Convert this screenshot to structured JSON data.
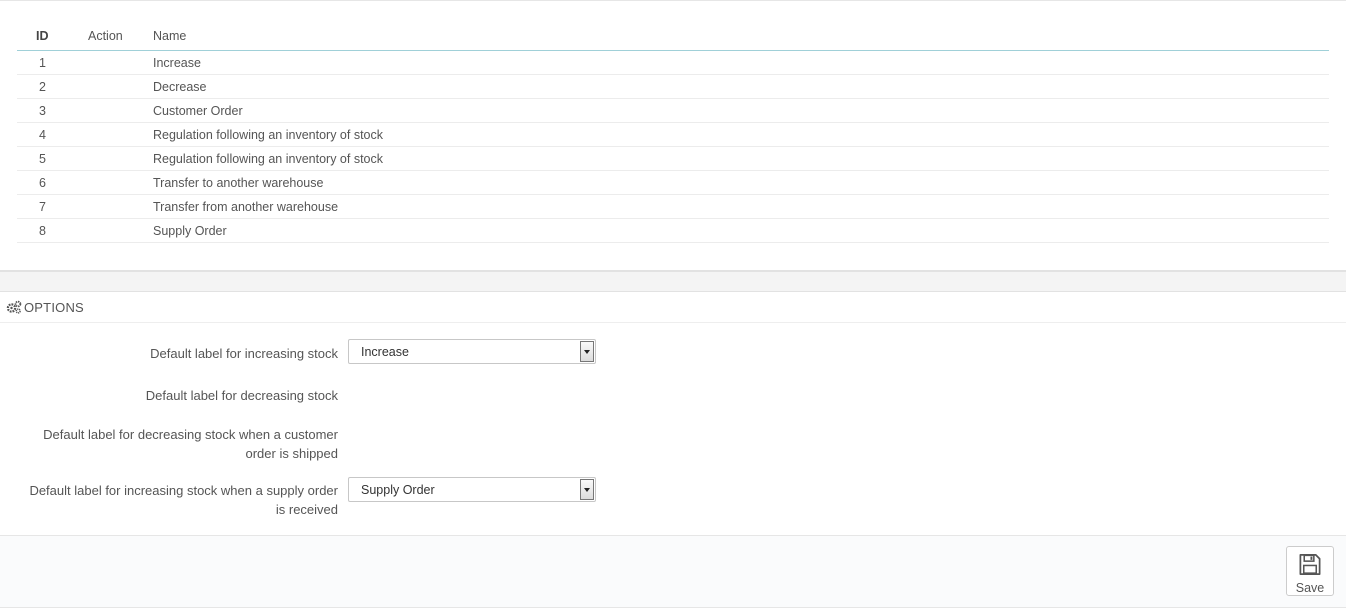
{
  "table": {
    "headers": {
      "id": "ID",
      "action": "Action",
      "name": "Name"
    },
    "rows": [
      {
        "id": "1",
        "name": "Increase"
      },
      {
        "id": "2",
        "name": "Decrease"
      },
      {
        "id": "3",
        "name": "Customer Order"
      },
      {
        "id": "4",
        "name": "Regulation following an inventory of stock"
      },
      {
        "id": "5",
        "name": "Regulation following an inventory of stock"
      },
      {
        "id": "6",
        "name": "Transfer to another warehouse"
      },
      {
        "id": "7",
        "name": "Transfer from another warehouse"
      },
      {
        "id": "8",
        "name": "Supply Order"
      }
    ]
  },
  "options": {
    "heading": "OPTIONS",
    "heading_icon": "cogs-icon",
    "fields": [
      {
        "label": "Default label for increasing stock",
        "value": "Increase"
      },
      {
        "label": "Default label for decreasing stock"
      },
      {
        "label_line1": "Default label for decreasing stock when a customer",
        "label_line2": "order is shipped"
      },
      {
        "label_line1": "Default label for increasing stock when a supply order",
        "label_line2": "is received",
        "value": "Supply Order"
      }
    ]
  },
  "footer": {
    "save_label": "Save",
    "save_icon": "floppy-disk-icon"
  }
}
